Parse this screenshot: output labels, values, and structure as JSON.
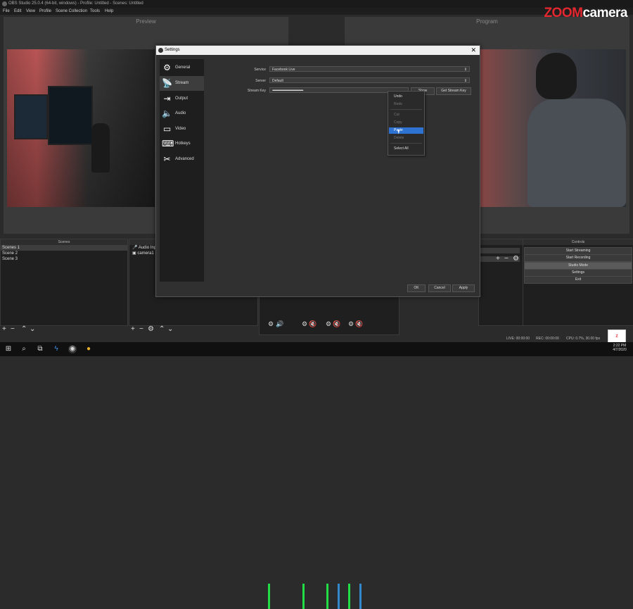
{
  "window": {
    "title": "OBS Studio 25.0.4 (64-bit, windows) - Profile: Untitled - Scenes: Untitled"
  },
  "menu": [
    "File",
    "Edit",
    "View",
    "Profile",
    "Scene Collection",
    "Tools",
    "Help"
  ],
  "brand": {
    "zoom": "ZOOM",
    "camera": "camera",
    "colors": {
      "zoom": "#e4272e",
      "camera": "#ffffff"
    }
  },
  "preview": {
    "label": "Preview"
  },
  "program": {
    "label": "Program"
  },
  "scenes": {
    "title": "Scenes",
    "items": [
      "Scenes 1",
      "Scene 2",
      "Scene 3"
    ]
  },
  "sources": {
    "items": [
      "Audio Inp",
      "camera1"
    ]
  },
  "controls": {
    "title": "Controls",
    "buttons": [
      "Start Streaming",
      "Start Recording",
      "Studio Mode",
      "Settings",
      "Exit"
    ]
  },
  "statusbar": {
    "live": "LIVE: 00:00:00",
    "rec": "REC: 00:00:00",
    "cpu": "CPU: 0.7%, 30.00 fps"
  },
  "taskbar": {
    "time": "2:22 PM",
    "date": "4/7/2020"
  },
  "dialog": {
    "title": "Settings",
    "nav": [
      {
        "label": "General",
        "icon": "gear-icon"
      },
      {
        "label": "Stream",
        "icon": "antenna-icon"
      },
      {
        "label": "Output",
        "icon": "output-icon"
      },
      {
        "label": "Audio",
        "icon": "speaker-icon"
      },
      {
        "label": "Video",
        "icon": "monitor-icon"
      },
      {
        "label": "Hotkeys",
        "icon": "keyboard-icon"
      },
      {
        "label": "Advanced",
        "icon": "tools-icon"
      }
    ],
    "service_label": "Service",
    "service_value": "Facebook Live",
    "server_label": "Server",
    "server_value": "Default",
    "key_label": "Stream Key",
    "key_value": "••••••••••••••••••••••••••••••••••••••••••••••••••••••••••",
    "show_label": "Show",
    "get_key_label": "Get Stream Key",
    "ok": "OK",
    "cancel": "Cancel",
    "apply": "Apply"
  },
  "context_menu": [
    "Undo",
    "Redo",
    "Cut",
    "Copy",
    "Paste",
    "Delete",
    "Select All"
  ]
}
